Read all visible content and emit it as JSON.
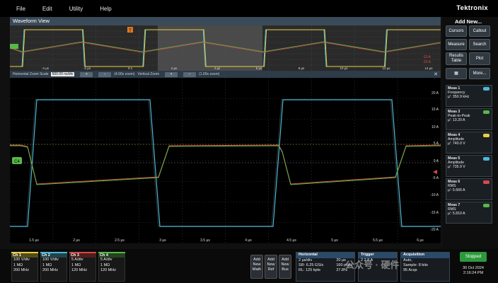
{
  "menu": [
    "File",
    "Edit",
    "Utility",
    "Help"
  ],
  "brand": "Tektronix",
  "waveform_view": {
    "title": "Waveform View",
    "overview_ticks": [
      "-4 µs",
      "-2 µs",
      "0 s",
      "2 µs",
      "4 µs",
      "6 µs",
      "8 µs",
      "10 µs",
      "12 µs",
      "14 µs"
    ],
    "overview_right_labels": [
      "-10 A",
      "-15 A"
    ],
    "trigger_marker": "T"
  },
  "zoom_bar": {
    "label": "Horizontal Zoom Scale",
    "value": "500.00 ns/div",
    "h_zoom": "(4.00x zoom)",
    "v_label": "Vertical Zoom",
    "v_zoom": "(1.00x zoom)",
    "close": "✕"
  },
  "zoom_view": {
    "x_ticks": [
      "1.5 µs",
      "2 µs",
      "2.5 µs",
      "3 µs",
      "3.5 µs",
      "4 µs",
      "4.5 µs",
      "5 µs",
      "5.5 µs",
      "6 µs"
    ],
    "y_ticks": [
      "20 A",
      "15 A",
      "10 A",
      "5 A",
      "0 A",
      "-5 A",
      "-10 A",
      "-15 A",
      "-20 A"
    ],
    "ch4_marker": "C4"
  },
  "right_panel": {
    "title": "Add New...",
    "buttons": [
      [
        "Cursors",
        "Callout"
      ],
      [
        "Measure",
        "Search"
      ],
      [
        "Results Table",
        "Plot"
      ],
      [
        "▦",
        "More..."
      ]
    ],
    "measurements": [
      {
        "title": "Meas 1",
        "label": "Frequency",
        "value": "µ': 350.9 kHz",
        "color": "#4ab8d8"
      },
      {
        "title": "Meas 3",
        "label": "Peak-to-Peak",
        "value": "µ': 13.20 A",
        "color": "#58b848"
      },
      {
        "title": "Meas 4",
        "label": "Amplitude",
        "value": "µ': 740.0 V",
        "color": "#e8d040"
      },
      {
        "title": "Meas 5",
        "label": "Amplitude",
        "value": "µ': 735.9 V",
        "color": "#4ab8d8"
      },
      {
        "title": "Meas 6",
        "label": "RMS",
        "value": "µ': 5.666 A",
        "color": "#d84848"
      },
      {
        "title": "Meas 7",
        "label": "RMS",
        "value": "µ': 5.810 A",
        "color": "#58b848"
      }
    ]
  },
  "channels": [
    {
      "name": "Ch 1",
      "scale": "100 V/div",
      "imp": "1 MΩ",
      "bw": "200 MHz",
      "color": "#e8d040"
    },
    {
      "name": "Ch 2",
      "scale": "100 V/div",
      "imp": "1 MΩ",
      "bw": "200 MHz",
      "color": "#4ab8d8"
    },
    {
      "name": "Ch 3",
      "scale": "5 A/div",
      "imp": "1 MΩ",
      "bw": "120 MHz",
      "color": "#d84848"
    },
    {
      "name": "Ch 4",
      "scale": "5 A/div",
      "imp": "1 MΩ",
      "bw": "120 MHz",
      "color": "#58b848"
    }
  ],
  "add_buttons": [
    "Add New Math",
    "Add New Ref",
    "Add New Bus"
  ],
  "horizontal": {
    "title": "Horizontal",
    "l1": "2 µs/div",
    "l2": "SR: 6.25 GS/s",
    "l3": "RL: 125 kpts",
    "r1": "20 µs",
    "r2": "160 ps/pt",
    "r3": "27.8%"
  },
  "trigger": {
    "title": "Trigger",
    "l1": "2",
    "l2": "2.8 A"
  },
  "acquisition": {
    "title": "Acquisition",
    "l1": "Auto,",
    "l2": "Sample: 8 bits",
    "l3": "95 Acqs"
  },
  "stop": "Stopped",
  "date": "30 Oct 2024",
  "time": "2:16:24 PM",
  "watermark": "公众号 · 硬件"
}
